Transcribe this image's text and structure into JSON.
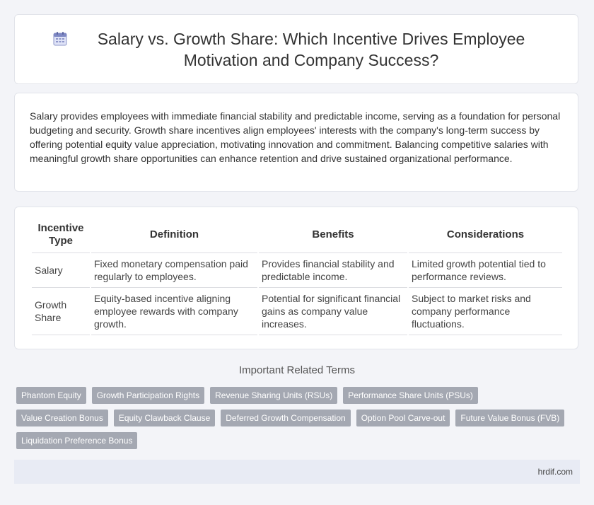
{
  "header": {
    "icon": "calendar-icon",
    "title": "Salary vs. Growth Share: Which Incentive Drives Employee Motivation and Company Success?"
  },
  "intro": "Salary provides employees with immediate financial stability and predictable income, serving as a foundation for personal budgeting and security. Growth share incentives align employees' interests with the company's long-term success by offering potential equity value appreciation, motivating innovation and commitment. Balancing competitive salaries with meaningful growth share opportunities can enhance retention and drive sustained organizational performance.",
  "table": {
    "headers": [
      "Incentive Type",
      "Definition",
      "Benefits",
      "Considerations"
    ],
    "rows": [
      [
        "Salary",
        "Fixed monetary compensation paid regularly to employees.",
        "Provides financial stability and predictable income.",
        "Limited growth potential tied to performance reviews."
      ],
      [
        "Growth Share",
        "Equity-based incentive aligning employee rewards with company growth.",
        "Potential for significant financial gains as company value increases.",
        "Subject to market risks and company performance fluctuations."
      ]
    ]
  },
  "related": {
    "title": "Important Related Terms",
    "tags": [
      "Phantom Equity",
      "Growth Participation Rights",
      "Revenue Sharing Units (RSUs)",
      "Performance Share Units (PSUs)",
      "Value Creation Bonus",
      "Equity Clawback Clause",
      "Deferred Growth Compensation",
      "Option Pool Carve-out",
      "Future Value Bonus (FVB)",
      "Liquidation Preference Bonus"
    ]
  },
  "footer": {
    "site": "hrdif.com"
  }
}
